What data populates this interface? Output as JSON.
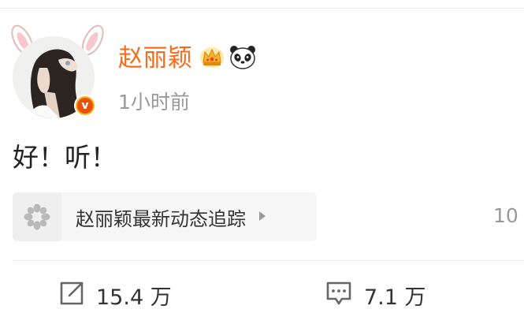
{
  "post": {
    "author": {
      "name": "赵丽颖",
      "avatar_icon": "profile-photo",
      "verified_icon": "verified-v-badge",
      "badges": [
        "crown-icon",
        "panda-icon"
      ]
    },
    "timestamp": "1小时前",
    "text": "好！听！",
    "topic_card": {
      "icon": "super-topic-flower-icon",
      "label": "赵丽颖最新动态追踪",
      "arrow_icon": "triangle-right-icon"
    },
    "clipped_right_text": "10",
    "actions": {
      "repost": {
        "icon": "repost-icon",
        "count": "15.4 万"
      },
      "comment": {
        "icon": "comment-icon",
        "count": "7.1 万"
      }
    }
  },
  "colors": {
    "author_name": "#f86d1a",
    "secondary_text": "#999999",
    "primary_text": "#333333",
    "card_background": "#f6f6f6",
    "divider": "#ececec",
    "verified_orange": "#e8520e",
    "verified_gold": "#f3b61f"
  }
}
